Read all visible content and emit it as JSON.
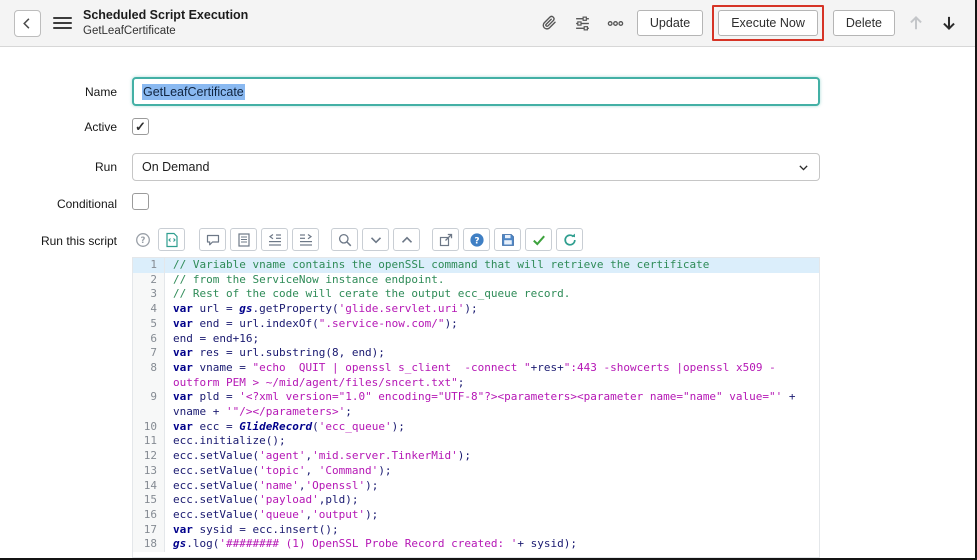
{
  "header": {
    "title": "Scheduled Script Execution",
    "subtitle": "GetLeafCertificate",
    "icons": [
      "back-icon",
      "menu-icon",
      "attachment-icon",
      "personalize-icon",
      "more-options-icon",
      "previous-record-icon",
      "next-record-icon"
    ],
    "buttons": {
      "update": "Update",
      "execute_now": "Execute Now",
      "delete": "Delete"
    }
  },
  "form": {
    "name": {
      "label": "Name",
      "value": "GetLeafCertificate"
    },
    "active": {
      "label": "Active",
      "checked": true
    },
    "run": {
      "label": "Run",
      "value": "On Demand"
    },
    "conditional": {
      "label": "Conditional",
      "checked": false
    },
    "script": {
      "label": "Run this script"
    }
  },
  "colors": {
    "focus": "#43b0a5",
    "selection": "#8ab9f1",
    "annotation": "#d63426",
    "comment": "#2e8b57",
    "keyword": "#00008b",
    "builtin": "#00008b",
    "string": "#b517b5",
    "plain": "#191970"
  },
  "editor": {
    "toolbar_icons": [
      "help-icon",
      "script-icon",
      "comment-icon",
      "document-icon",
      "indent-left-icon",
      "indent-right-icon",
      "search-icon",
      "chevron-down-icon",
      "chevron-up-icon",
      "popout-icon",
      "api-help-icon",
      "save-icon",
      "syntax-check-icon",
      "script-refresh-icon"
    ],
    "active_line": 1,
    "lines": [
      {
        "num": 1,
        "tokens": [
          [
            "c",
            "// Variable vname contains the openSSL command that will retrieve the certificate"
          ]
        ]
      },
      {
        "num": 2,
        "tokens": [
          [
            "c",
            "// from the ServiceNow instance endpoint."
          ]
        ]
      },
      {
        "num": 3,
        "tokens": [
          [
            "c",
            "// Rest of the code will cerate the output ecc_queue record."
          ]
        ]
      },
      {
        "num": 4,
        "tokens": [
          [
            "k",
            "var"
          ],
          [
            "p",
            " url = "
          ],
          [
            "b",
            "gs"
          ],
          [
            "p",
            ".getProperty("
          ],
          [
            "s",
            "'glide.servlet.uri'"
          ],
          [
            "p",
            ");"
          ]
        ]
      },
      {
        "num": 5,
        "tokens": [
          [
            "k",
            "var"
          ],
          [
            "p",
            " end = url.indexOf("
          ],
          [
            "s",
            "\".service-now.com/\""
          ],
          [
            "p",
            ");"
          ]
        ]
      },
      {
        "num": 6,
        "tokens": [
          [
            "p",
            "end = end+16;"
          ]
        ]
      },
      {
        "num": 7,
        "tokens": [
          [
            "k",
            "var"
          ],
          [
            "p",
            " res = url.substring(8, end);"
          ]
        ]
      },
      {
        "num": 8,
        "tokens": [
          [
            "k",
            "var"
          ],
          [
            "p",
            " vname = "
          ],
          [
            "s",
            "\"echo  QUIT | openssl s_client  -connect \""
          ],
          [
            "p",
            "+res+"
          ],
          [
            "s",
            "\":443 -showcerts |openssl x509 -outform PEM > ~/mid/agent/files/sncert.txt\""
          ],
          [
            "p",
            ";"
          ]
        ]
      },
      {
        "num": 9,
        "tokens": [
          [
            "k",
            "var"
          ],
          [
            "p",
            " pld = "
          ],
          [
            "s",
            "'<?xml version=\"1.0\" encoding=\"UTF-8\"?><parameters><parameter name=\"name\" value=\"'"
          ],
          [
            "p",
            " + vname + "
          ],
          [
            "s",
            "'\"/></parameters>'"
          ],
          [
            "p",
            ";"
          ]
        ]
      },
      {
        "num": 10,
        "tokens": [
          [
            "k",
            "var"
          ],
          [
            "p",
            " ecc = "
          ],
          [
            "b",
            "GlideRecord"
          ],
          [
            "p",
            "("
          ],
          [
            "s",
            "'ecc_queue'"
          ],
          [
            "p",
            ");"
          ]
        ]
      },
      {
        "num": 11,
        "tokens": [
          [
            "p",
            "ecc.initialize();"
          ]
        ]
      },
      {
        "num": 12,
        "tokens": [
          [
            "p",
            "ecc.setValue("
          ],
          [
            "s",
            "'agent'"
          ],
          [
            "p",
            ","
          ],
          [
            "s",
            "'mid.server.TinkerMid'"
          ],
          [
            "p",
            ");"
          ]
        ]
      },
      {
        "num": 13,
        "tokens": [
          [
            "p",
            "ecc.setValue("
          ],
          [
            "s",
            "'topic'"
          ],
          [
            "p",
            ", "
          ],
          [
            "s",
            "'Command'"
          ],
          [
            "p",
            ");"
          ]
        ]
      },
      {
        "num": 14,
        "tokens": [
          [
            "p",
            "ecc.setValue("
          ],
          [
            "s",
            "'name'"
          ],
          [
            "p",
            ","
          ],
          [
            "s",
            "'Openssl'"
          ],
          [
            "p",
            ");"
          ]
        ]
      },
      {
        "num": 15,
        "tokens": [
          [
            "p",
            "ecc.setValue("
          ],
          [
            "s",
            "'payload'"
          ],
          [
            "p",
            ",pld);"
          ]
        ]
      },
      {
        "num": 16,
        "tokens": [
          [
            "p",
            "ecc.setValue("
          ],
          [
            "s",
            "'queue'"
          ],
          [
            "p",
            ","
          ],
          [
            "s",
            "'output'"
          ],
          [
            "p",
            ");"
          ]
        ]
      },
      {
        "num": 17,
        "tokens": [
          [
            "k",
            "var"
          ],
          [
            "p",
            " sysid = ecc.insert();"
          ]
        ]
      },
      {
        "num": 18,
        "tokens": [
          [
            "b",
            "gs"
          ],
          [
            "p",
            ".log("
          ],
          [
            "s",
            "'######## (1) OpenSSL Probe Record created: '"
          ],
          [
            "p",
            "+ sysid);"
          ]
        ]
      }
    ]
  }
}
